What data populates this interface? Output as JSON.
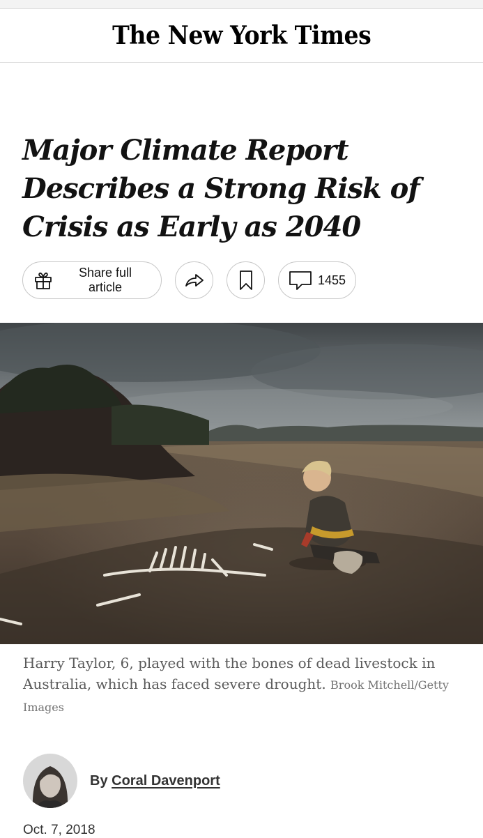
{
  "masthead": {
    "logo_text": "The New York Times"
  },
  "article": {
    "headline": "Major Climate Report Describes a Strong Risk of Crisis as Early as 2040"
  },
  "actions": {
    "share_label": "Share full article",
    "share_icon": "gift-icon",
    "forward_icon": "share-arrow-icon",
    "save_icon": "bookmark-icon",
    "comments_icon": "comment-bubble-icon",
    "comments_count": "1455"
  },
  "photo": {
    "caption": "Harry Taylor, 6, played with the bones of dead livestock in Australia, which has faced severe drought.",
    "credit": "Brook Mitchell/Getty Images"
  },
  "byline": {
    "by": "By",
    "author": "Coral Davenport"
  },
  "date": "Oct. 7, 2018"
}
